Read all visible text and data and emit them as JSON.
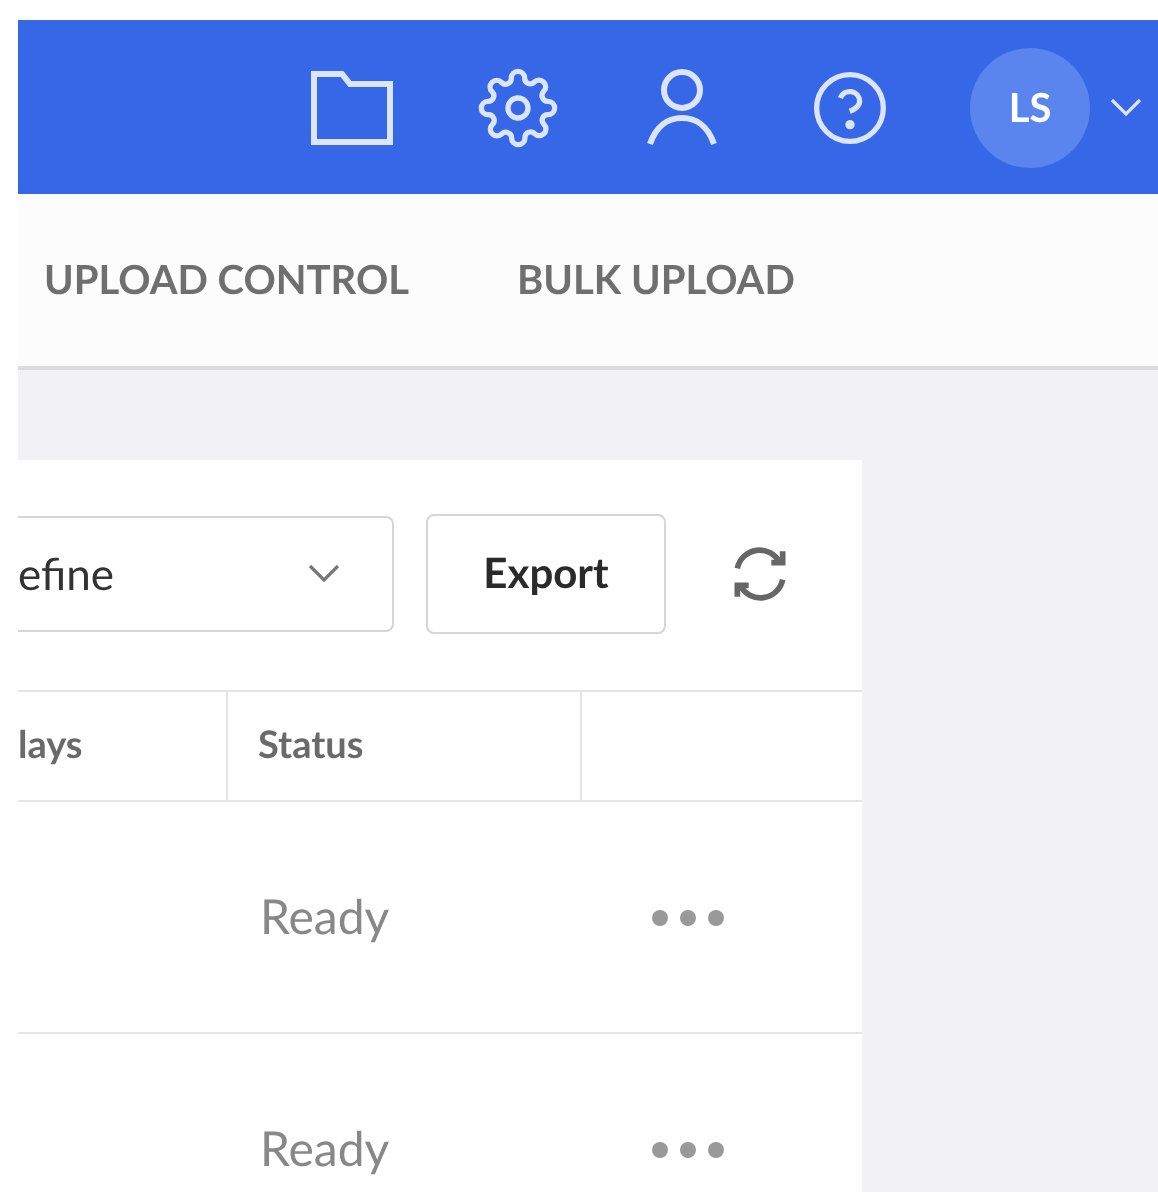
{
  "header": {
    "avatar": "LS"
  },
  "tabs": [
    {
      "label": "UPLOAD CONTROL",
      "selected": false
    },
    {
      "label": "BULK UPLOAD",
      "selected": false
    }
  ],
  "toolbar": {
    "dropdown": "efine",
    "export": "Export"
  },
  "table": {
    "columns": [
      "lays",
      "Status"
    ],
    "rows": [
      {
        "status": "Ready"
      },
      {
        "status": "Ready"
      }
    ]
  }
}
